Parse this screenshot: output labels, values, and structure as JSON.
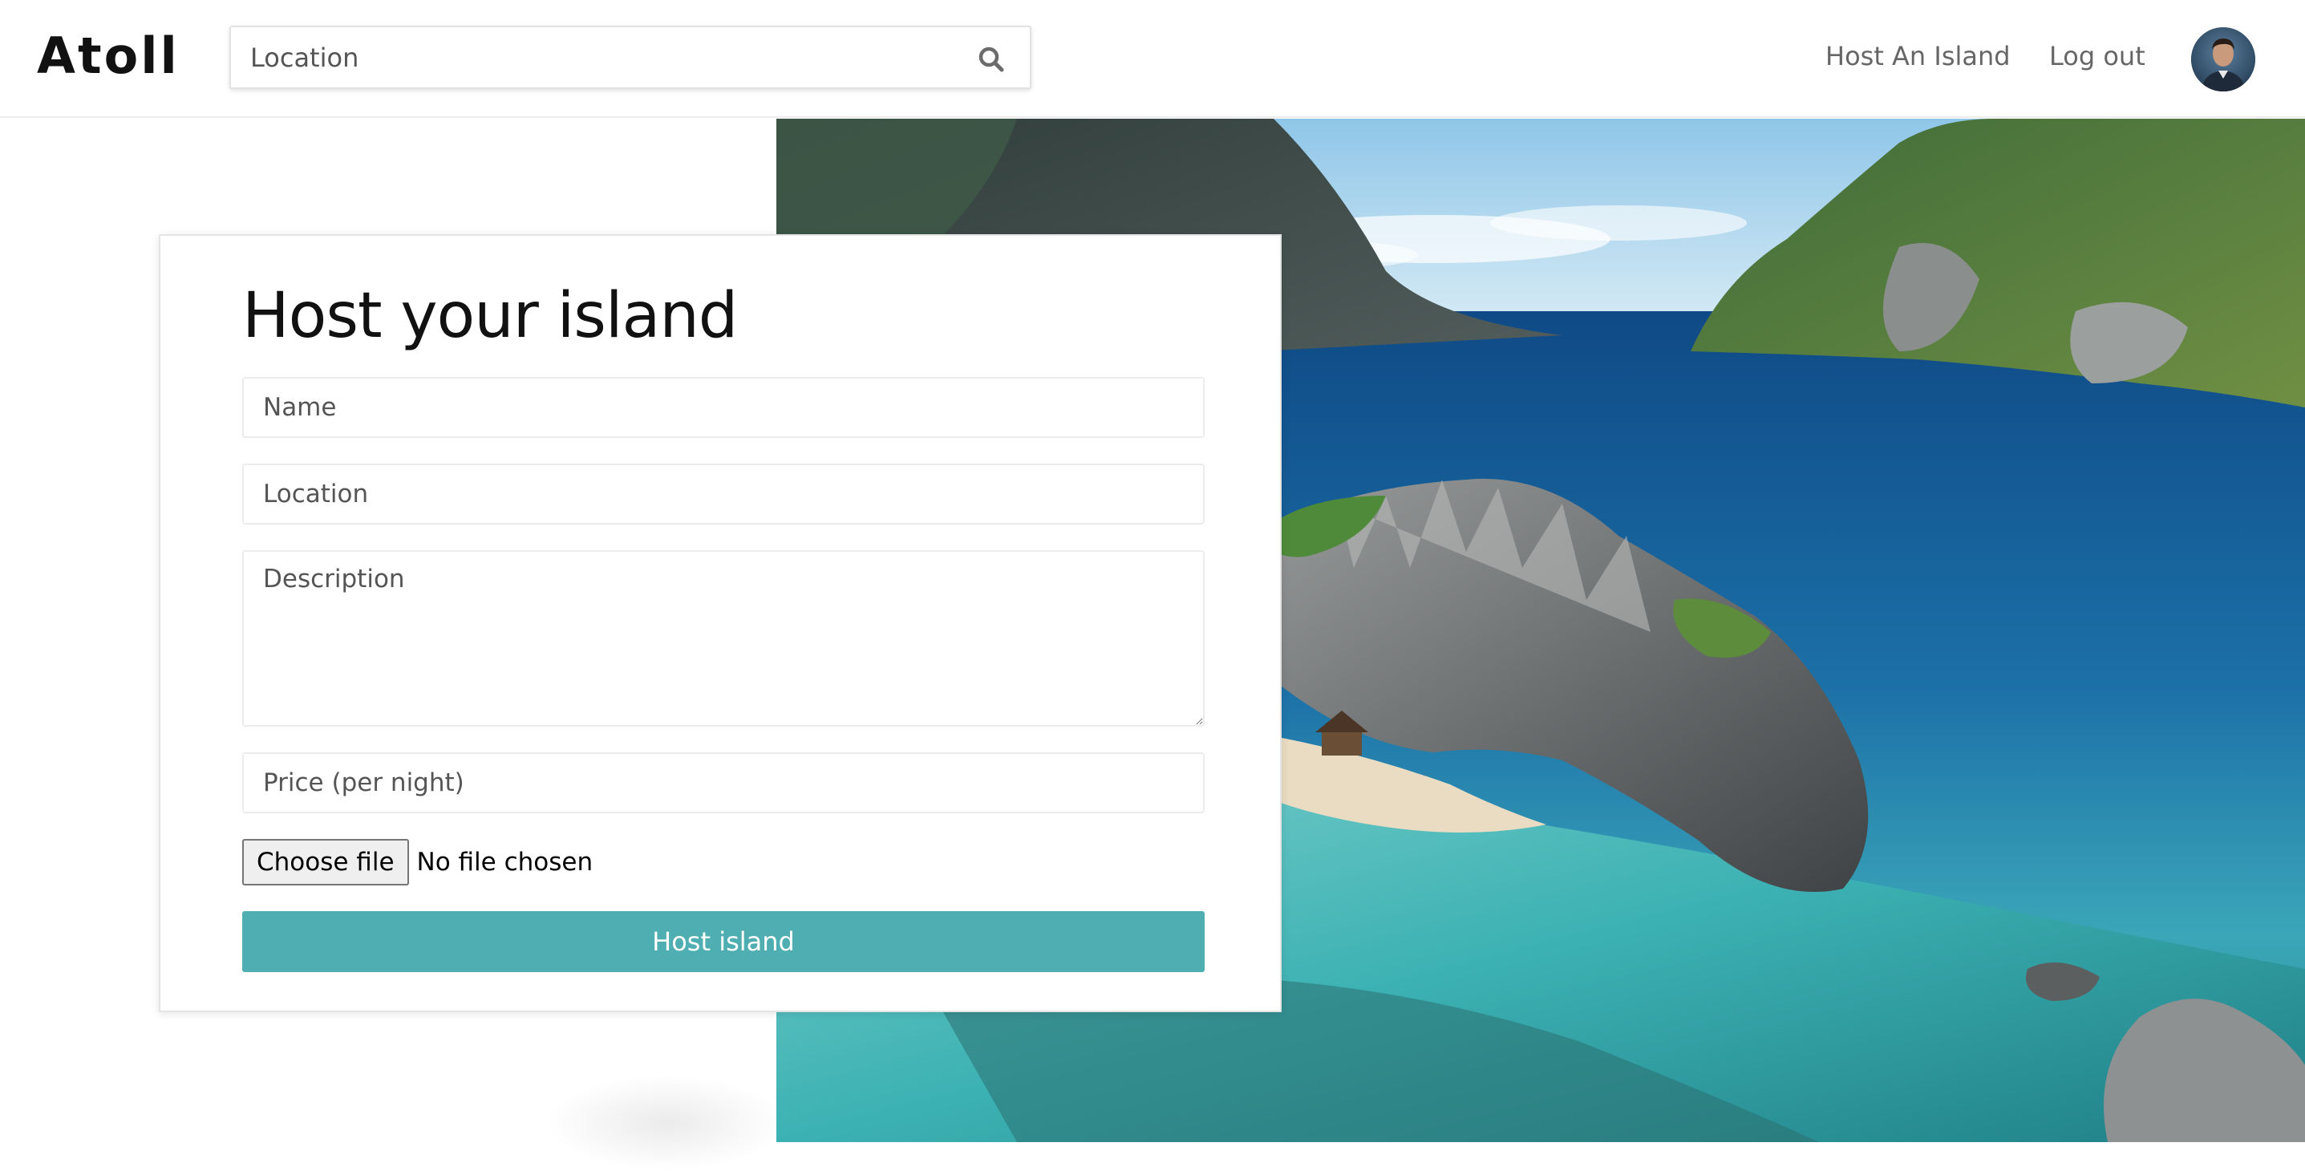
{
  "brand": {
    "name": "Atoll"
  },
  "search": {
    "placeholder": "Location",
    "icon": "search-icon"
  },
  "nav": {
    "host_link": "Host An Island",
    "logout_link": "Log out"
  },
  "form": {
    "title": "Host your island",
    "name_placeholder": "Name",
    "location_placeholder": "Location",
    "description_placeholder": "Description",
    "price_placeholder": "Price (per night)",
    "file_button": "Choose file",
    "file_status": "No file chosen",
    "submit_label": "Host island"
  },
  "colors": {
    "accent": "#4faeb1",
    "nav_text": "#666666",
    "title_text": "#111111"
  }
}
